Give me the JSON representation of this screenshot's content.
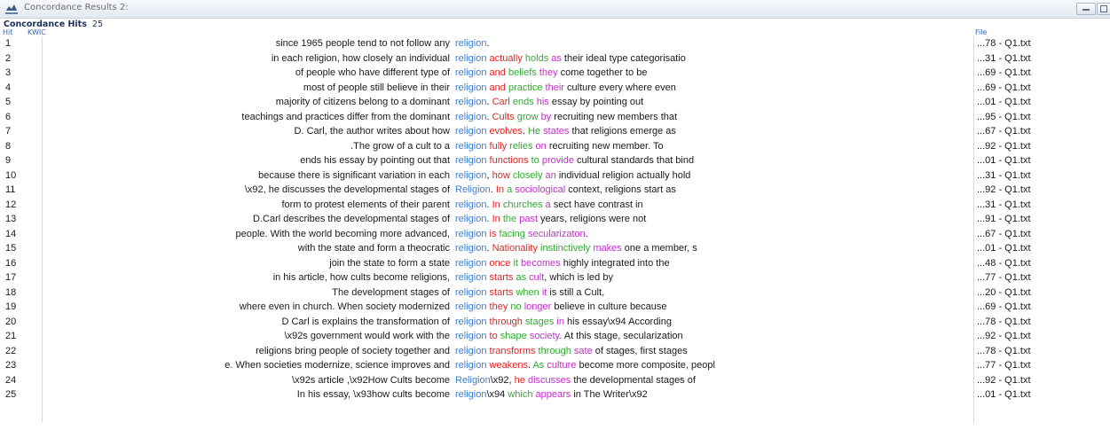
{
  "window": {
    "title": "Concordance Results 2:"
  },
  "summary": {
    "label": "Concordance Hits",
    "count": "25"
  },
  "columns": {
    "hit": "Hit",
    "kwic": "KWIC",
    "file": "File"
  },
  "colors": {
    "keyword": "#3a7fd5",
    "red": "#e02424",
    "green": "#33a833",
    "magenta": "#c42fcc"
  },
  "rows": [
    {
      "n": "1",
      "left": "since 1965 people tend to not follow any",
      "kw": "religion",
      "right": [
        {
          "t": "."
        }
      ],
      "file": "...78 - Q1.txt"
    },
    {
      "n": "2",
      "left": "in each religion, how closely an individual",
      "kw": "religion",
      "right": [
        {
          "t": "actually",
          "c": "r"
        },
        {
          "t": " "
        },
        {
          "t": "holds",
          "c": "g"
        },
        {
          "t": " "
        },
        {
          "t": "as",
          "c": "m"
        },
        {
          "t": " their ideal type  categorisatio"
        }
      ],
      "file": "...31 - Q1.txt"
    },
    {
      "n": "3",
      "left": "of people who have different type of",
      "kw": "religion",
      "right": [
        {
          "t": "and",
          "c": "r"
        },
        {
          "t": " "
        },
        {
          "t": "beliefs",
          "c": "g"
        },
        {
          "t": " "
        },
        {
          "t": "they",
          "c": "m"
        },
        {
          "t": "  come together to be"
        }
      ],
      "file": "...69 - Q1.txt"
    },
    {
      "n": "4",
      "left": "most of people still believe in their",
      "kw": "religion",
      "right": [
        {
          "t": "and",
          "c": "r"
        },
        {
          "t": " "
        },
        {
          "t": "practice",
          "c": "g"
        },
        {
          "t": "  "
        },
        {
          "t": "their",
          "c": "m"
        },
        {
          "t": " culture every where even"
        }
      ],
      "file": "...69 - Q1.txt"
    },
    {
      "n": "5",
      "left": "majority of citizens belong to a dominant",
      "kw": "religion",
      "right": [
        {
          "t": ".  "
        },
        {
          "t": "Carl",
          "c": "r"
        },
        {
          "t": " "
        },
        {
          "t": "ends",
          "c": "g"
        },
        {
          "t": " "
        },
        {
          "t": "his",
          "c": "m"
        },
        {
          "t": " essay by pointing out"
        }
      ],
      "file": "...01 - Q1.txt"
    },
    {
      "n": "6",
      "left": "teachings and practices differ from the dominant",
      "kw": "religion",
      "right": [
        {
          "t": ". "
        },
        {
          "t": "Cults",
          "c": "r"
        },
        {
          "t": " "
        },
        {
          "t": "grow",
          "c": "g"
        },
        {
          "t": " "
        },
        {
          "t": "by",
          "c": "m"
        },
        {
          "t": " recruiting new members that"
        }
      ],
      "file": "...95 - Q1.txt"
    },
    {
      "n": "7",
      "left": "D. Carl, the author writes about how",
      "kw": "religion",
      "right": [
        {
          "t": "  "
        },
        {
          "t": "evolves",
          "c": "r"
        },
        {
          "t": ". "
        },
        {
          "t": "He",
          "c": "g"
        },
        {
          "t": " "
        },
        {
          "t": "states",
          "c": "m"
        },
        {
          "t": " that religions emerge as"
        }
      ],
      "file": "...67 - Q1.txt"
    },
    {
      "n": "8",
      "left": ".The grow of a cult to a",
      "kw": "religion",
      "right": [
        {
          "t": "fully",
          "c": "r"
        },
        {
          "t": " "
        },
        {
          "t": "relies",
          "c": "g"
        },
        {
          "t": " "
        },
        {
          "t": "on",
          "c": "m"
        },
        {
          "t": "  recruiting new member. To"
        }
      ],
      "file": "...92 - Q1.txt"
    },
    {
      "n": "9",
      "left": "ends his essay by pointing out that",
      "kw": "religion",
      "right": [
        {
          "t": "functions",
          "c": "r"
        },
        {
          "t": " "
        },
        {
          "t": "to",
          "c": "g"
        },
        {
          "t": " "
        },
        {
          "t": "provide",
          "c": "m"
        },
        {
          "t": " cultural standards that bind"
        }
      ],
      "file": "...01 - Q1.txt"
    },
    {
      "n": "10",
      "left": "because there is  significant variation in each",
      "kw": "religion",
      "right": [
        {
          "t": ", "
        },
        {
          "t": "how",
          "c": "r"
        },
        {
          "t": " "
        },
        {
          "t": "closely",
          "c": "g"
        },
        {
          "t": " "
        },
        {
          "t": "an",
          "c": "m"
        },
        {
          "t": " individual religion actually hold"
        }
      ],
      "file": "...31 - Q1.txt"
    },
    {
      "n": "11",
      "left": "\\x92, he discusses the developmental stages of",
      "kw": "Religion",
      "right": [
        {
          "t": ". "
        },
        {
          "t": "In",
          "c": "r"
        },
        {
          "t": " "
        },
        {
          "t": "a",
          "c": "g"
        },
        {
          "t": " "
        },
        {
          "t": "sociological",
          "c": "m"
        },
        {
          "t": " context, religions start as"
        }
      ],
      "file": "...92 - Q1.txt"
    },
    {
      "n": "12",
      "left": "form to protest elements of their  parent",
      "kw": "religion",
      "right": [
        {
          "t": ". "
        },
        {
          "t": "In",
          "c": "r"
        },
        {
          "t": " "
        },
        {
          "t": "churches",
          "c": "g"
        },
        {
          "t": " "
        },
        {
          "t": "a",
          "c": "m"
        },
        {
          "t": " sect have contrast in"
        }
      ],
      "file": "...31 - Q1.txt"
    },
    {
      "n": "13",
      "left": "D.Carl describes the  developmental stages of",
      "kw": "religion",
      "right": [
        {
          "t": ". "
        },
        {
          "t": "In",
          "c": "r"
        },
        {
          "t": " "
        },
        {
          "t": "the",
          "c": "g"
        },
        {
          "t": " "
        },
        {
          "t": "past",
          "c": "m"
        },
        {
          "t": " years, religions were not"
        }
      ],
      "file": "...91 - Q1.txt"
    },
    {
      "n": "14",
      "left": "people. With the world becoming more advanced,",
      "kw": "religion",
      "right": [
        {
          "t": "is",
          "c": "r"
        },
        {
          "t": " "
        },
        {
          "t": "facing",
          "c": "g"
        },
        {
          "t": " "
        },
        {
          "t": "secularizaton",
          "c": "m"
        },
        {
          "t": "."
        }
      ],
      "file": "...67 - Q1.txt"
    },
    {
      "n": "15",
      "left": "with the state and form a theocratic",
      "kw": "religion",
      "right": [
        {
          "t": ".  "
        },
        {
          "t": "Nationality",
          "c": "r"
        },
        {
          "t": " "
        },
        {
          "t": "instinctively",
          "c": "g"
        },
        {
          "t": " "
        },
        {
          "t": "makes",
          "c": "m"
        },
        {
          "t": " one a member, s"
        }
      ],
      "file": "...01 - Q1.txt"
    },
    {
      "n": "16",
      "left": "join the state to form a state",
      "kw": "religion",
      "right": [
        {
          "t": " "
        },
        {
          "t": "once",
          "c": "r"
        },
        {
          "t": " "
        },
        {
          "t": "it",
          "c": "g"
        },
        {
          "t": " "
        },
        {
          "t": "becomes",
          "c": "m"
        },
        {
          "t": " highly integrated into the"
        }
      ],
      "file": "...48 - Q1.txt"
    },
    {
      "n": "17",
      "left": "in his article, how cults become religions,",
      "kw": "religion",
      "right": [
        {
          "t": "starts",
          "c": "r"
        },
        {
          "t": " "
        },
        {
          "t": "as",
          "c": "g"
        },
        {
          "t": " "
        },
        {
          "t": "cult",
          "c": "m"
        },
        {
          "t": ", which is led by"
        }
      ],
      "file": "...77 - Q1.txt"
    },
    {
      "n": "18",
      "left": "The development stages of",
      "kw": "religion",
      "right": [
        {
          "t": "starts",
          "c": "r"
        },
        {
          "t": " "
        },
        {
          "t": "when",
          "c": "g"
        },
        {
          "t": " "
        },
        {
          "t": "it",
          "c": "m"
        },
        {
          "t": " is still a Cult,"
        }
      ],
      "file": "...20 - Q1.txt"
    },
    {
      "n": "19",
      "left": "where even in church. When society modernized",
      "kw": "religion",
      "right": [
        {
          "t": "they",
          "c": "r"
        },
        {
          "t": " "
        },
        {
          "t": "no",
          "c": "g"
        },
        {
          "t": " "
        },
        {
          "t": "longer",
          "c": "m"
        },
        {
          "t": " believe in  culture because"
        }
      ],
      "file": "...69 - Q1.txt"
    },
    {
      "n": "20",
      "left": "D Carl is explains the transformation of",
      "kw": "religion",
      "right": [
        {
          "t": "through",
          "c": "r"
        },
        {
          "t": " "
        },
        {
          "t": "stages",
          "c": "g"
        },
        {
          "t": " "
        },
        {
          "t": "in",
          "c": "m"
        },
        {
          "t": " his essay\\x94   According"
        }
      ],
      "file": "...78 - Q1.txt"
    },
    {
      "n": "21",
      "left": "\\x92s  government would work with the",
      "kw": "religion",
      "right": [
        {
          "t": "to",
          "c": "r"
        },
        {
          "t": " "
        },
        {
          "t": "shape",
          "c": "g"
        },
        {
          "t": " "
        },
        {
          "t": "society",
          "c": "m"
        },
        {
          "t": ". At this stage, secularization"
        }
      ],
      "file": "...92 - Q1.txt"
    },
    {
      "n": "22",
      "left": "religions bring people of society together and",
      "kw": "religion",
      "right": [
        {
          "t": "transforms",
          "c": "r"
        },
        {
          "t": " "
        },
        {
          "t": "through",
          "c": "g"
        },
        {
          "t": " "
        },
        {
          "t": "sate",
          "c": "m"
        },
        {
          "t": " of  stages, first stages"
        }
      ],
      "file": "...78 - Q1.txt"
    },
    {
      "n": "23",
      "left": "e. When societies modernize, science improves and",
      "kw": "religion",
      "right": [
        {
          "t": "weakens",
          "c": "r"
        },
        {
          "t": ". "
        },
        {
          "t": "As",
          "c": "g"
        },
        {
          "t": " "
        },
        {
          "t": "culture",
          "c": "m"
        },
        {
          "t": " become more  composite, peopl"
        }
      ],
      "file": "...77 - Q1.txt"
    },
    {
      "n": "24",
      "left": "\\x92s article ,\\x92How Cults become",
      "kw": "Religion",
      "right": [
        {
          "t": "\\x92, "
        },
        {
          "t": "he",
          "c": "r"
        },
        {
          "t": " "
        },
        {
          "t": "discusses",
          "c": "m"
        },
        {
          "t": " the developmental stages of"
        }
      ],
      "file": "...92 - Q1.txt"
    },
    {
      "n": "25",
      "left": "In his essay, \\x93how cults become",
      "kw": "religion",
      "right": [
        {
          "t": "\\x94 "
        },
        {
          "t": "which",
          "c": "g"
        },
        {
          "t": " "
        },
        {
          "t": "appears",
          "c": "m"
        },
        {
          "t": " in The Writer\\x92"
        }
      ],
      "file": "...01 - Q1.txt"
    }
  ]
}
